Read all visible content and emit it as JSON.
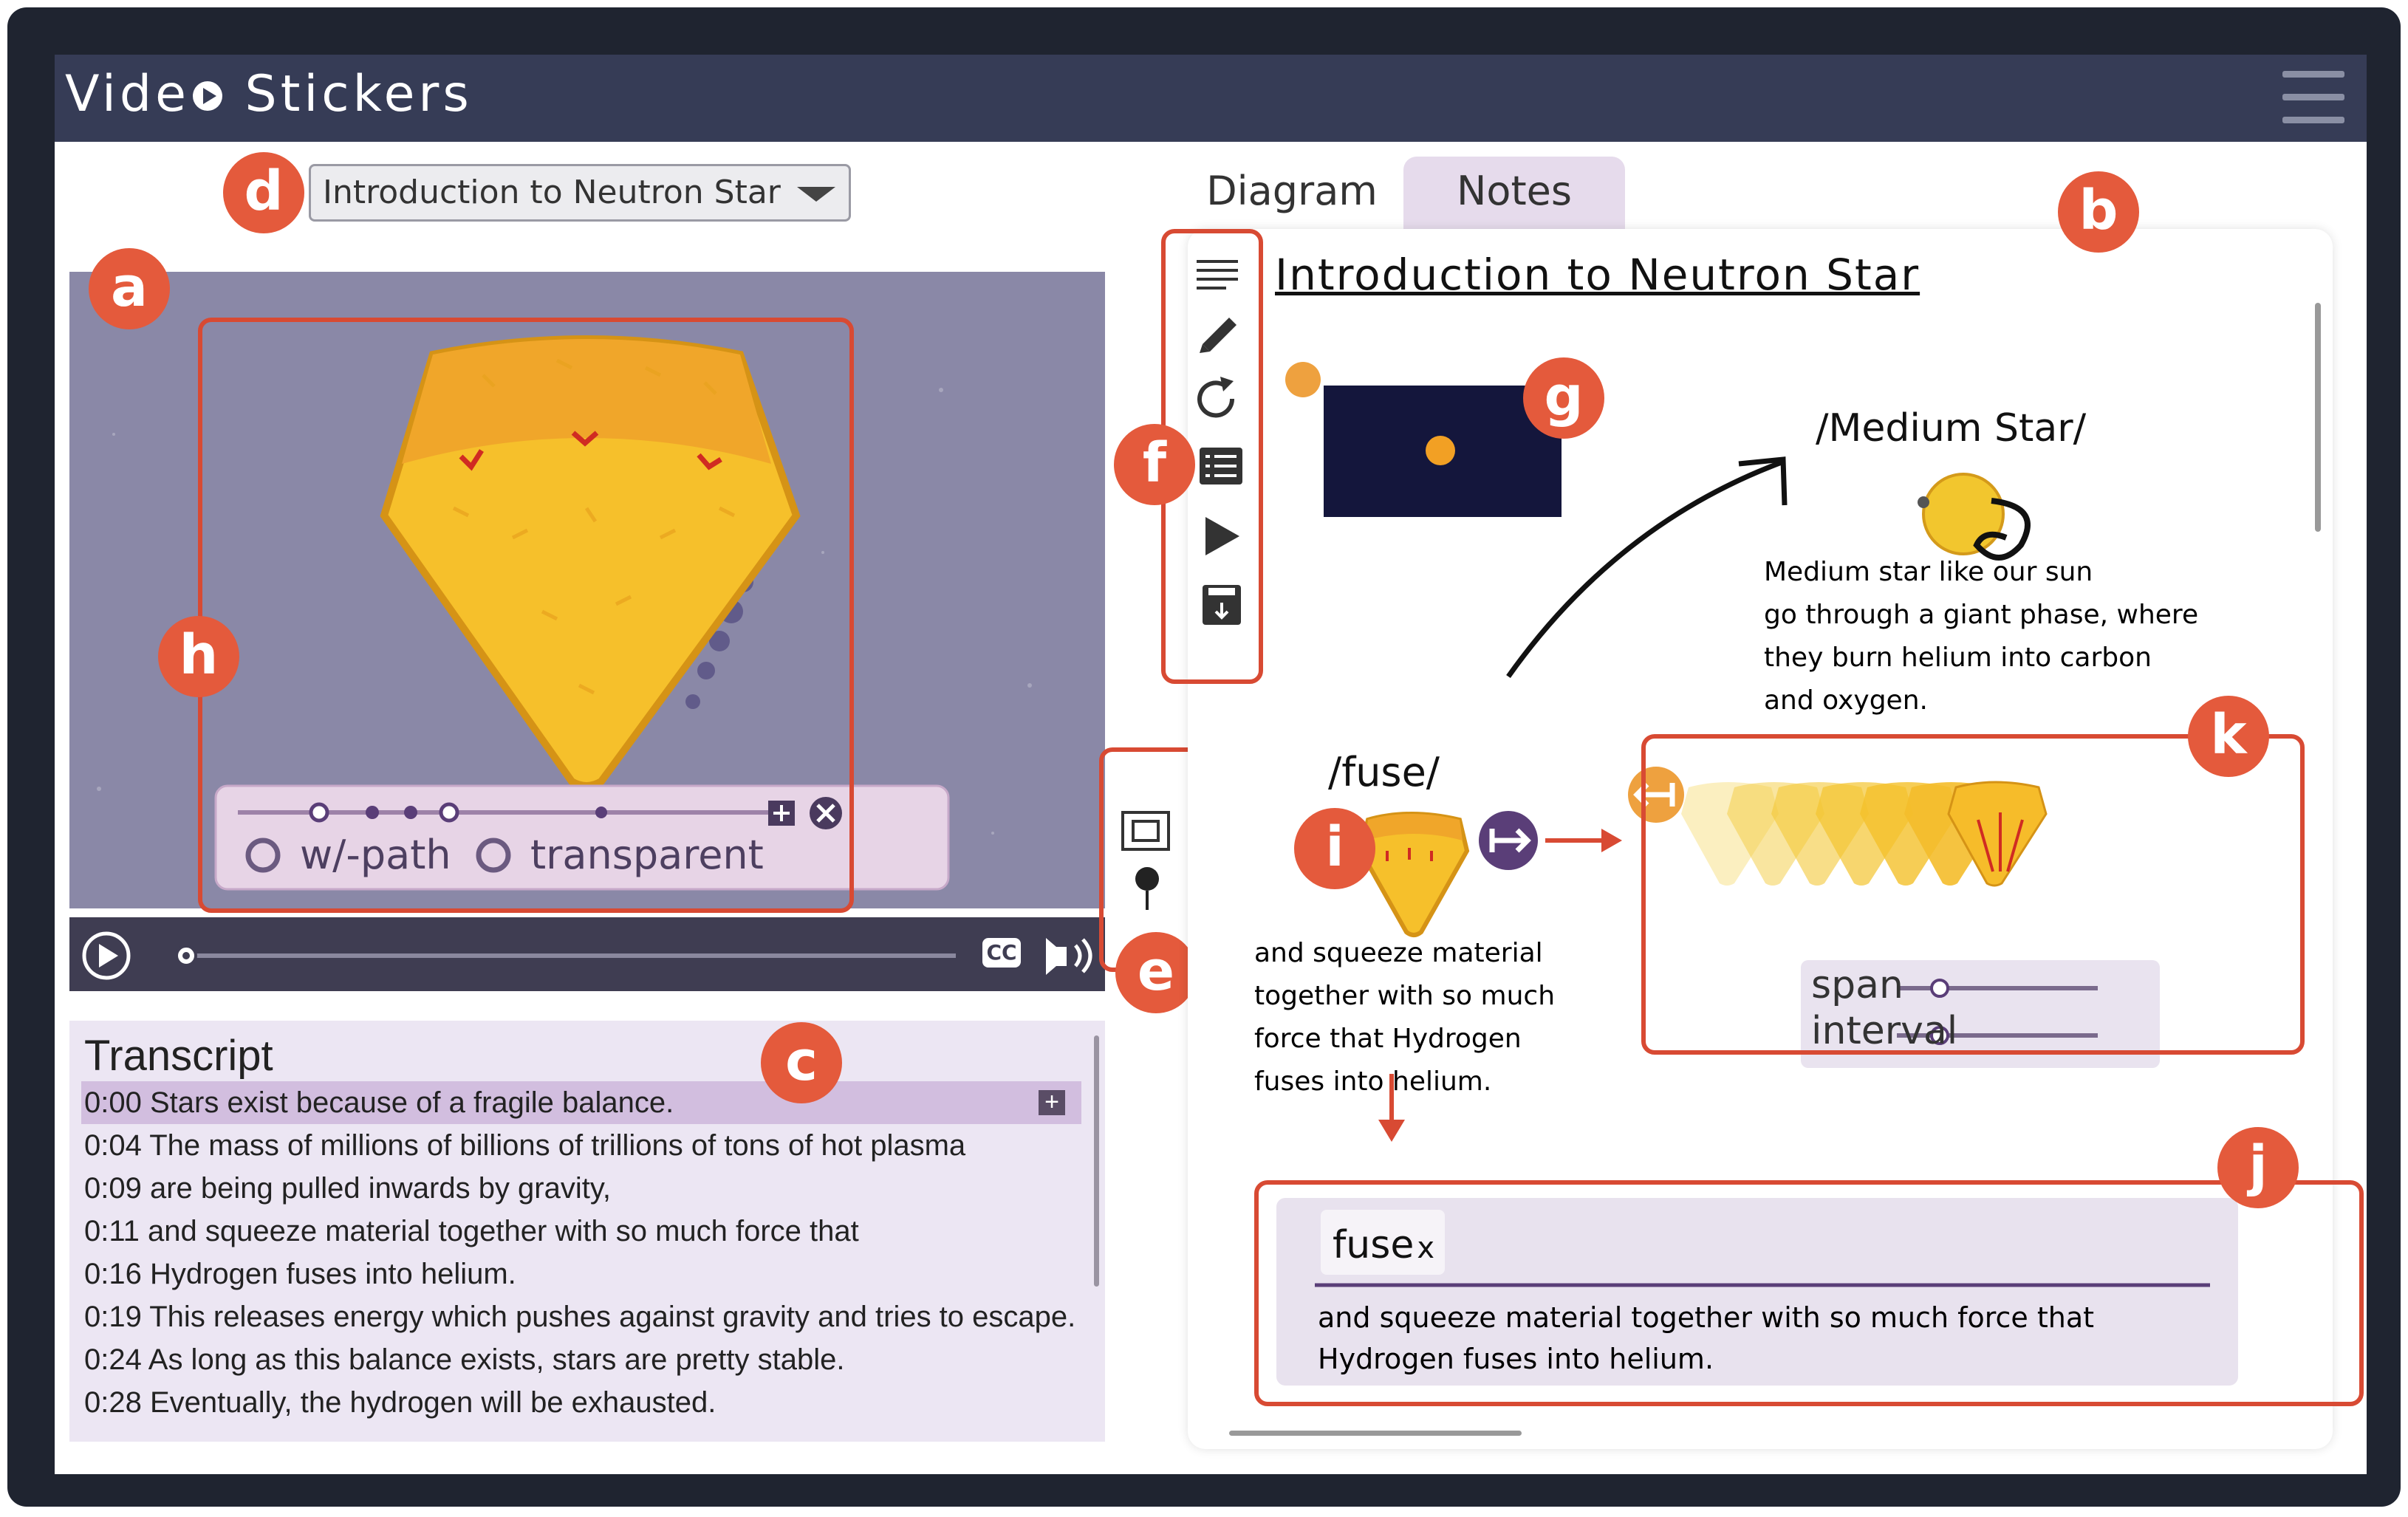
{
  "app": {
    "title_pre": "Vide",
    "title_post": " Stickers"
  },
  "video_selector": {
    "selected": "Introduction to Neutron Star"
  },
  "markers": {
    "a": "a",
    "b": "b",
    "c": "c",
    "d": "d",
    "e": "e",
    "f": "f",
    "g": "g",
    "h": "h",
    "i": "i",
    "j": "j",
    "k": "k"
  },
  "sticker_controls": {
    "option_path": "w/-path",
    "option_transparent": "transparent"
  },
  "player": {
    "cc_label": "CC"
  },
  "transcript": {
    "title": "Transcript",
    "rows": [
      {
        "time": "0:00",
        "text": " Stars exist because of a fragile balance."
      },
      {
        "time": "0:04",
        "text": " The mass of millions of billions of trillions of tons of hot plasma"
      },
      {
        "time": "0:09",
        "text": " are being pulled inwards by gravity,"
      },
      {
        "time": "0:11",
        "text": " and squeeze material together with so much force that"
      },
      {
        "time": "0:16",
        "text": " Hydrogen fuses into helium."
      },
      {
        "time": "0:19",
        "text": " This releases energy which pushes against gravity and tries to escape."
      },
      {
        "time": "0:24",
        "text": " As long as this balance exists, stars are pretty stable."
      },
      {
        "time": "0:28",
        "text": " Eventually, the hydrogen will be exhausted."
      }
    ]
  },
  "tabs": {
    "diagram": "Diagram",
    "notes": "Notes"
  },
  "diagram": {
    "title": "Introduction to Neutron Star",
    "medium_star_label": "/Medium Star/",
    "medium_star_notes": [
      "Medium star like our sun",
      "go through a giant phase, where",
      "they burn helium into carbon",
      "and oxygen."
    ],
    "fuse_label": "/fuse/",
    "fuse_notes": [
      "and squeeze material",
      "together with so much",
      "force that Hydrogen",
      "fuses into helium."
    ],
    "span_label": "span",
    "interval_label": "interval",
    "span_value": 0.2,
    "interval_value": 0.2,
    "note_card": {
      "tag": "fuse",
      "tag_close": "x",
      "lines": [
        "and squeeze material together with so much force that",
        "Hydrogen fuses into helium."
      ]
    }
  },
  "colors": {
    "accent": "#e45a3c",
    "header": "#363c56",
    "highlight": "#d2bedf",
    "purple": "#5a3e78"
  }
}
